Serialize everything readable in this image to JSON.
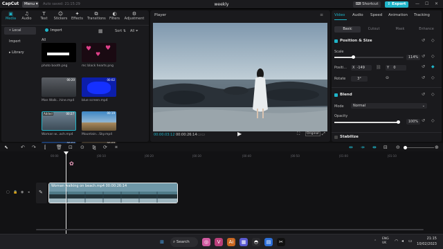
{
  "titlebar": {
    "app_name": "CapCut",
    "menu_label": "Menu",
    "autosave_text": "Auto saved: 21:15:29",
    "project_title": "weekly",
    "shortcut_label": "Shortcut",
    "export_label": "Export"
  },
  "media_toolbar": {
    "tabs": [
      {
        "label": "Media",
        "icon": "media-icon"
      },
      {
        "label": "Audio",
        "icon": "audio-icon"
      },
      {
        "label": "Text",
        "icon": "text-icon"
      },
      {
        "label": "Stickers",
        "icon": "stickers-icon"
      },
      {
        "label": "Effects",
        "icon": "effects-icon"
      },
      {
        "label": "Transitions",
        "icon": "transitions-icon"
      },
      {
        "label": "Filters",
        "icon": "filters-icon"
      },
      {
        "label": "Adjustment",
        "icon": "adjustment-icon"
      }
    ]
  },
  "side_nav": {
    "items": [
      "• Local",
      "Import",
      "▸ Library"
    ]
  },
  "media": {
    "import_label": "Import",
    "sort_label": "Sort",
    "all_label": "All",
    "filter_label": "All",
    "items": [
      {
        "name": "photo booth.png",
        "badge": ""
      },
      {
        "name": "mc black hearts.png",
        "badge": ""
      },
      {
        "name": "Man Walk...hine.mp4",
        "badge": "00:20"
      },
      {
        "name": "blue screen.mp4",
        "badge": "00:02"
      },
      {
        "name": "Woman w...ach.mp4",
        "badge": "00:27",
        "added": "Added"
      },
      {
        "name": "Mountain...Sky.mp4",
        "badge": "00:19"
      },
      {
        "name": "",
        "badge": "00:04"
      },
      {
        "name": "",
        "badge": "00:08"
      }
    ]
  },
  "player": {
    "title": "Player",
    "current_time": "00:00:03:12",
    "total_time": "00:00:26:14",
    "original_label": "Original"
  },
  "inspector": {
    "tabs": [
      "Video",
      "Audio",
      "Speed",
      "Animation",
      "Tracking"
    ],
    "sub_tabs": [
      "Basic",
      "Cutout",
      "Mask",
      "Enhance"
    ],
    "position_size_title": "Position & Size",
    "scale_label": "Scale",
    "scale_value": "114%",
    "scale_fraction": 0.27,
    "position_label": "Positi...",
    "pos_x_label": "X",
    "pos_x_value": "-149",
    "pos_y_label": "Y",
    "pos_y_value": "0",
    "rotate_label": "Rotate",
    "rotate_value": "3°",
    "blend_title": "Blend",
    "mode_label": "Mode",
    "mode_value": "Normal",
    "opacity_label": "Opacity",
    "opacity_value": "100%",
    "opacity_fraction": 1.0,
    "stabilize_label": "Stabilize"
  },
  "timeline": {
    "ruler": [
      "00:00",
      "|00:10",
      "|00:20",
      "|00:30",
      "|00:40",
      "|00:50",
      "|01:00",
      "|01:10"
    ],
    "clip_label": "Woman walking on beach.mp4   00:00:26:14",
    "cover_label": "Cover"
  },
  "taskbar": {
    "search_label": "Search",
    "time": "21:15",
    "date": "10/02/2023",
    "lang": "ENG UK"
  },
  "colors": {
    "accent": "#1fb4c8",
    "panel": "#1a1a1d",
    "background": "#0f0f10"
  }
}
